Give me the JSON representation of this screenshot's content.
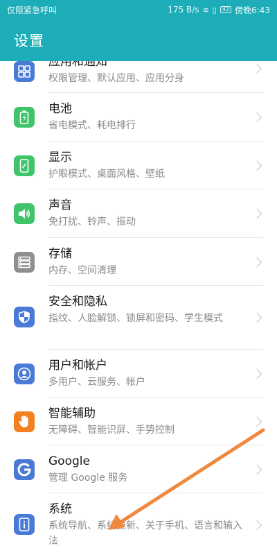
{
  "statusbar": {
    "left_text": "仅限紧急呼叫",
    "speed": "175 B/s",
    "battery": "42",
    "time": "傍晚6:43"
  },
  "appbar": {
    "title": "设置"
  },
  "items": [
    {
      "title": "应用和通知",
      "subtitle": "权限管理、默认应用、应用分身",
      "icon": "apps-grid-icon",
      "color": "#4a7ad8"
    },
    {
      "title": "电池",
      "subtitle": "省电模式、耗电排行",
      "icon": "battery-icon",
      "color": "#3fc46a"
    },
    {
      "title": "显示",
      "subtitle": "护眼模式、桌面风格、壁纸",
      "icon": "display-icon",
      "color": "#3fc46a"
    },
    {
      "title": "声音",
      "subtitle": "免打扰、铃声、振动",
      "icon": "speaker-icon",
      "color": "#3fc46a"
    },
    {
      "title": "存储",
      "subtitle": "内存、空间清理",
      "icon": "storage-icon",
      "color": "#8f8f8f"
    },
    {
      "title": "安全和隐私",
      "subtitle": "指纹、人脸解锁、锁屏和密码、学生模式",
      "icon": "shield-icon",
      "color": "#4a7ad8"
    },
    {
      "title": "用户和帐户",
      "subtitle": "多用户、云服务、帐户",
      "icon": "user-icon",
      "color": "#4a7ad8"
    },
    {
      "title": "智能辅助",
      "subtitle": "无障碍、智能识屏、手势控制",
      "icon": "hand-icon",
      "color": "#f27f21"
    },
    {
      "title": "Google",
      "subtitle": "管理 Google 服务",
      "icon": "google-g-icon",
      "color": "#4a7ad8"
    },
    {
      "title": "系统",
      "subtitle": "系统导航、系统更新、关于手机、语言和输入法",
      "icon": "info-icon",
      "color": "#4a7ad8"
    }
  ],
  "overlay": {
    "arrow_color": "#f0883e"
  }
}
